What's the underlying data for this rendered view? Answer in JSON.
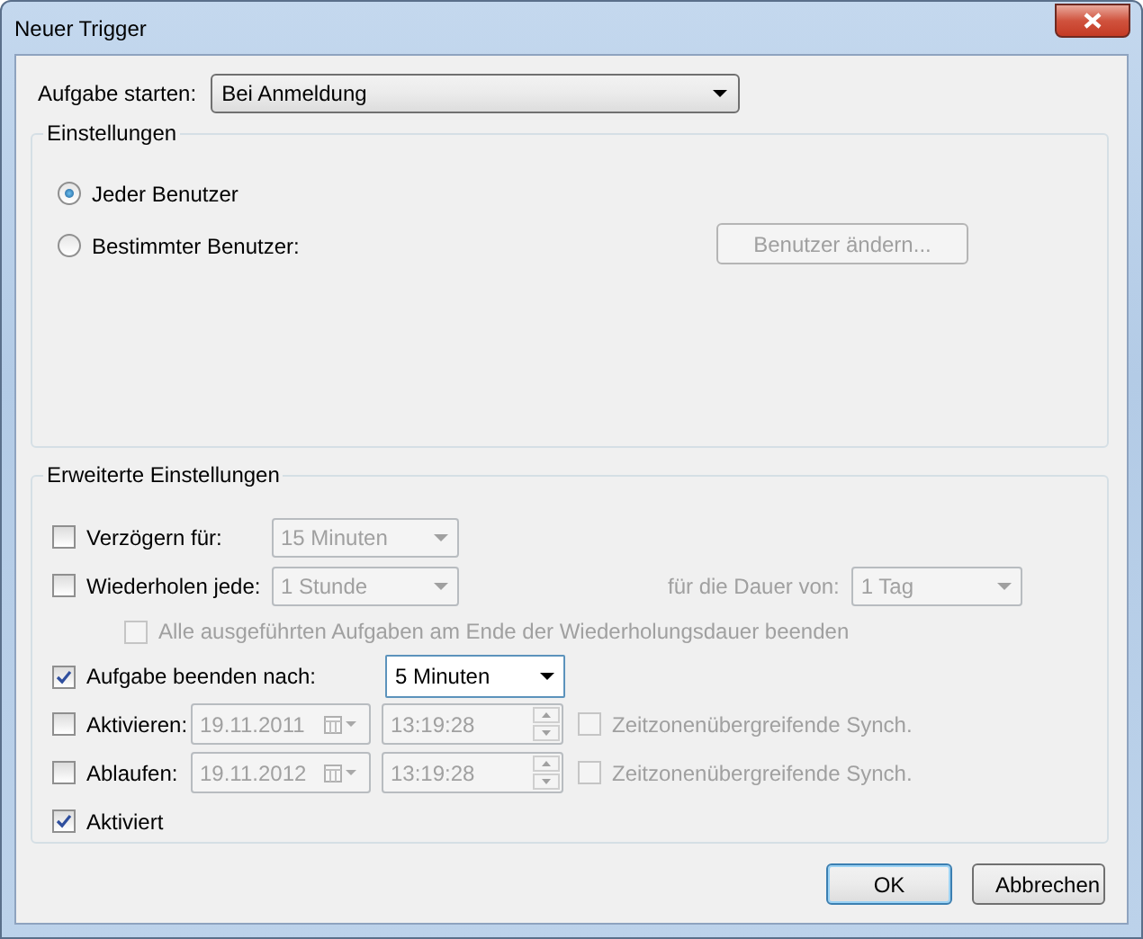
{
  "window": {
    "title": "Neuer Trigger"
  },
  "start": {
    "label": "Aufgabe starten:",
    "value": "Bei Anmeldung"
  },
  "settings": {
    "title": "Einstellungen",
    "options": [
      {
        "label": "Jeder Benutzer",
        "selected": true
      },
      {
        "label": "Bestimmter Benutzer:",
        "selected": false
      }
    ],
    "button": {
      "label": "Benutzer ändern...",
      "disabled": true
    }
  },
  "advanced": {
    "title": "Erweiterte Einstellungen",
    "rows": [
      {
        "kind": "combo",
        "label": "Verzögern für:",
        "checked": false,
        "value": "15 Minuten",
        "disabled": true
      },
      {
        "kind": "combo",
        "label": "Wiederholen jede:",
        "checked": false,
        "value": "1 Stunde",
        "disabled": true,
        "extra_label": "für die Dauer von:",
        "extra_value": "1 Tag"
      },
      {
        "kind": "sub",
        "label": "Alle ausgeführten Aufgaben am Ende der Wiederholungsdauer beenden",
        "checked": false,
        "disabled": true
      },
      {
        "kind": "combo",
        "label": "Aufgabe beenden nach:",
        "checked": true,
        "value": "5 Minuten",
        "disabled": false
      },
      {
        "kind": "datetime",
        "label": "Aktivieren:",
        "checked": false,
        "date": "19.11.2011",
        "time": "13:19:28",
        "disabled": true,
        "sync_label": "Zeitzonenübergreifende Synch.",
        "sync_checked": false
      },
      {
        "kind": "datetime",
        "label": "Ablaufen:",
        "checked": false,
        "date": "19.11.2012",
        "time": "13:19:28",
        "disabled": true,
        "sync_label": "Zeitzonenübergreifende Synch.",
        "sync_checked": false
      },
      {
        "kind": "check",
        "label": "Aktiviert",
        "checked": true
      }
    ]
  },
  "buttons": [
    {
      "label": "OK",
      "default": true
    },
    {
      "label": "Abbrechen",
      "default": false
    }
  ]
}
